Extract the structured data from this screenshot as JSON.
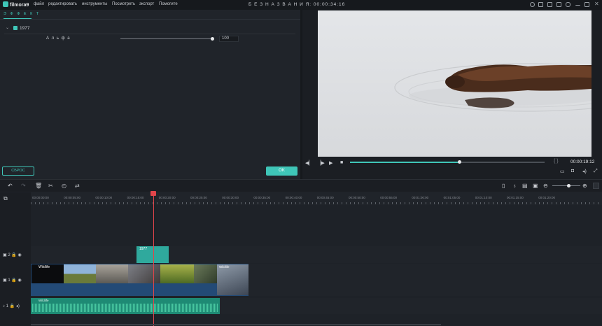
{
  "app": {
    "logo": "filmora9",
    "project_title": "Б Е З Н А З В А Н И Я:",
    "project_time": "00:00:34:16"
  },
  "menu": [
    "файл",
    "редактировать",
    "инструменты",
    "Посмотреть",
    "экспорт",
    "Помогите"
  ],
  "effect_panel": {
    "tab": "Э Ф Ф Е К Т",
    "effect_name": "1977",
    "param_label": "А л ь ф а",
    "param_value": "100",
    "param_level": 1.0,
    "reset_label": "СБРОС",
    "ok_label": "OK"
  },
  "preview": {
    "progress": 0.565,
    "time": "00:00:19:12",
    "brackets": "{ }"
  },
  "timeline": {
    "ruler": [
      "00:00:00:00",
      "00:00:05:00",
      "00:00:10:00",
      "00:00:15:00",
      "00:00:20:00",
      "00:00:25:00",
      "00:00:30:00",
      "00:00:35:00",
      "00:00:40:00",
      "00:00:45:00",
      "00:00:50:00",
      "00:00:55:00",
      "00:01:00:00",
      "00:01:05:00",
      "00:01:10:00",
      "00:01:15:00",
      "00:01:20:00"
    ],
    "tracks": [
      {
        "label": "2"
      },
      {
        "label": "1"
      },
      {
        "label": "1"
      }
    ],
    "effect_clip_label": "1977",
    "video_clip_label": "Wildlife",
    "audio_clip_label": "Wildlife",
    "video_clip2_label": "Wildlife"
  },
  "colors": {
    "accent": "#3fc6b8",
    "playhead": "#e0454a",
    "video_clip": "#234a76",
    "audio_clip": "#1e8a74"
  }
}
